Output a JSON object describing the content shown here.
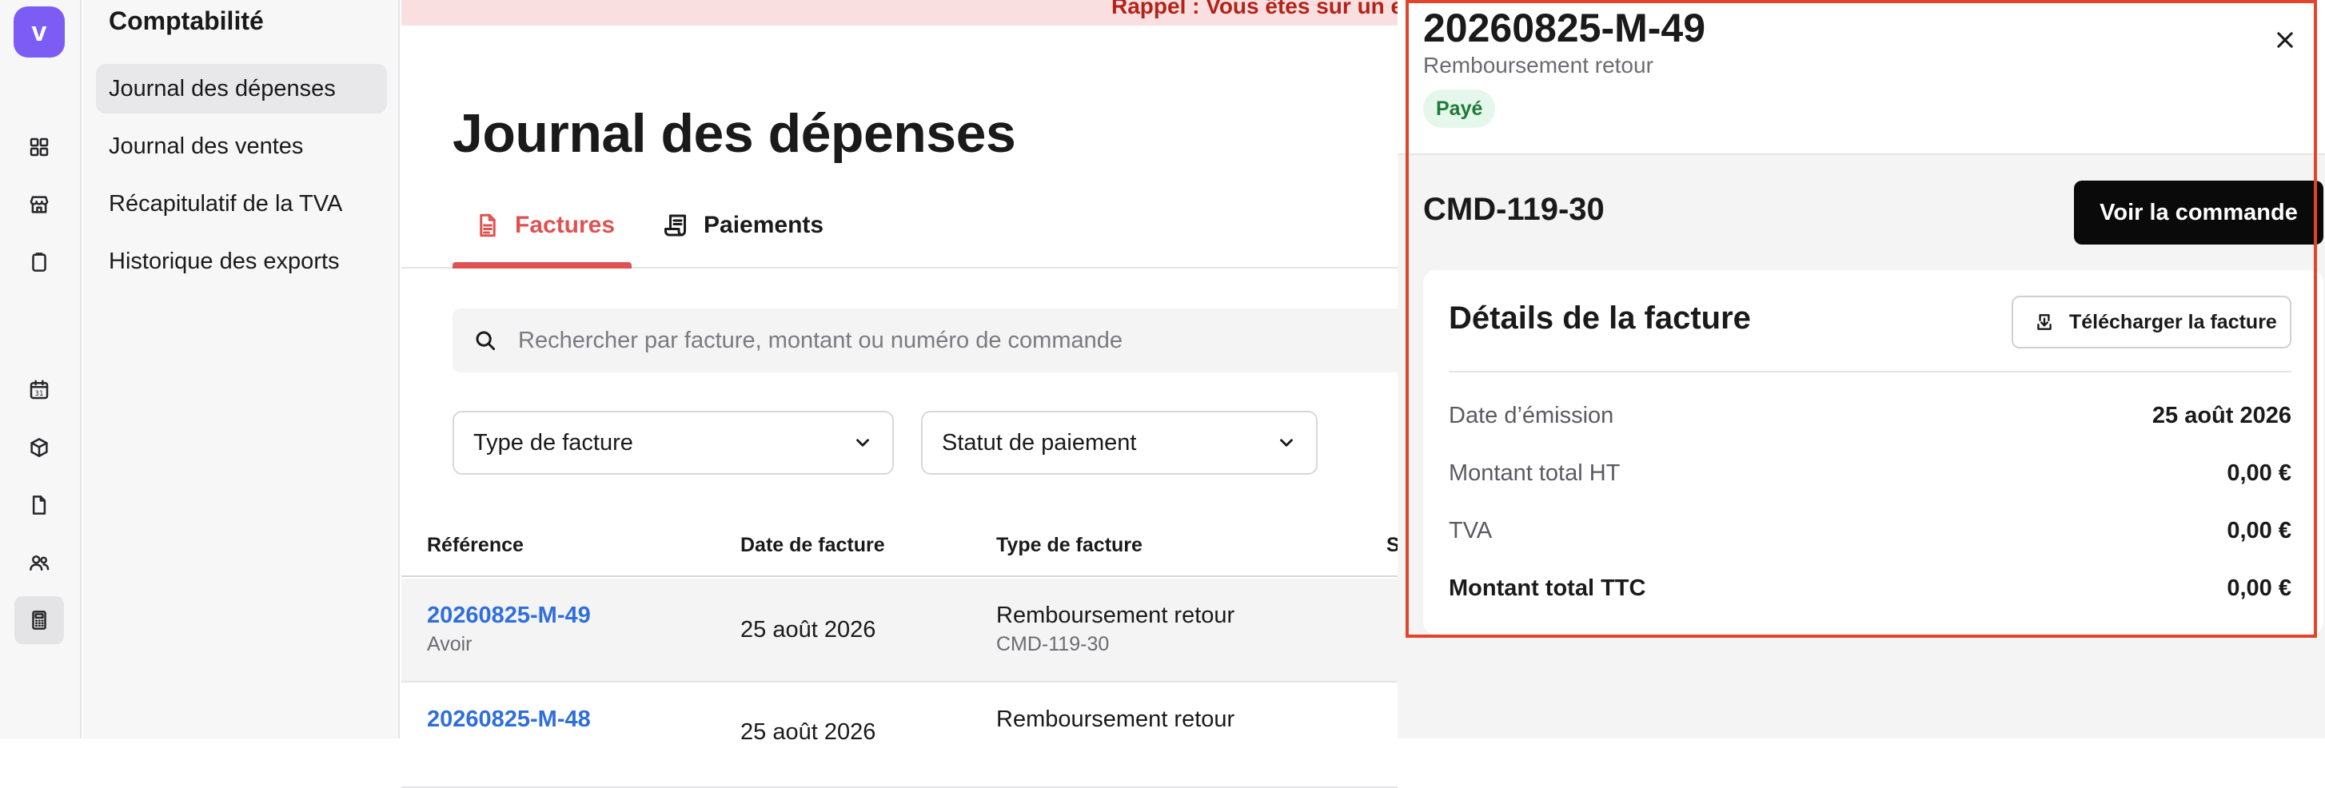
{
  "app": {
    "logo_letter": "v"
  },
  "rail": {
    "icons": [
      "grid-icon",
      "store-icon",
      "clipboard-icon",
      "calendar-icon",
      "box-icon",
      "document-icon",
      "users-icon",
      "calculator-icon"
    ],
    "calendar_day": "31",
    "active": "calculator-icon"
  },
  "subnav": {
    "title": "Comptabilité",
    "items": [
      {
        "label": "Journal des dépenses",
        "active": true
      },
      {
        "label": "Journal des ventes",
        "active": false
      },
      {
        "label": "Récapitulatif de la TVA",
        "active": false
      },
      {
        "label": "Historique des exports",
        "active": false
      }
    ]
  },
  "banner": {
    "text": "Rappel : Vous êtes sur un e"
  },
  "main": {
    "title": "Journal des dépenses",
    "tabs": [
      {
        "label": "Factures",
        "active": true
      },
      {
        "label": "Paiements",
        "active": false
      }
    ],
    "search": {
      "placeholder": "Rechercher par facture, montant ou numéro de commande",
      "value": ""
    },
    "filters": {
      "invoice_type": "Type de facture",
      "payment_status": "Statut de paiement"
    },
    "table": {
      "headers": [
        "Référence",
        "Date de facture",
        "Type de facture",
        "S"
      ],
      "rows": [
        {
          "ref": "20260825-M-49",
          "ref_sub": "Avoir",
          "date": "25 août 2026",
          "type": "Remboursement retour",
          "type_sub": "CMD-119-30",
          "selected": true
        },
        {
          "ref": "20260825-M-48",
          "ref_sub": "",
          "date": "25 août 2026",
          "type": "Remboursement retour",
          "type_sub": "",
          "selected": false
        }
      ]
    }
  },
  "drawer": {
    "title": "20260825-M-49",
    "subtitle": "Remboursement retour",
    "status": "Payé",
    "order_id": "CMD-119-30",
    "order_button": "Voir la commande",
    "card": {
      "title": "Détails de la facture",
      "download_button": "Télécharger la facture",
      "rows": [
        {
          "label": "Date d’émission",
          "value": "25 août 2026"
        },
        {
          "label": "Montant total HT",
          "value": "0,00 €"
        },
        {
          "label": "TVA",
          "value": "0,00 €"
        },
        {
          "label": "Montant total TTC",
          "value": "0,00 €"
        }
      ]
    }
  },
  "colors": {
    "accent": "#e05252",
    "brand": "#7c5cf5",
    "link": "#2f6fdb",
    "paid_bg": "#e5f6ea",
    "paid_text": "#1f7a3a",
    "highlight": "#e0452b"
  }
}
